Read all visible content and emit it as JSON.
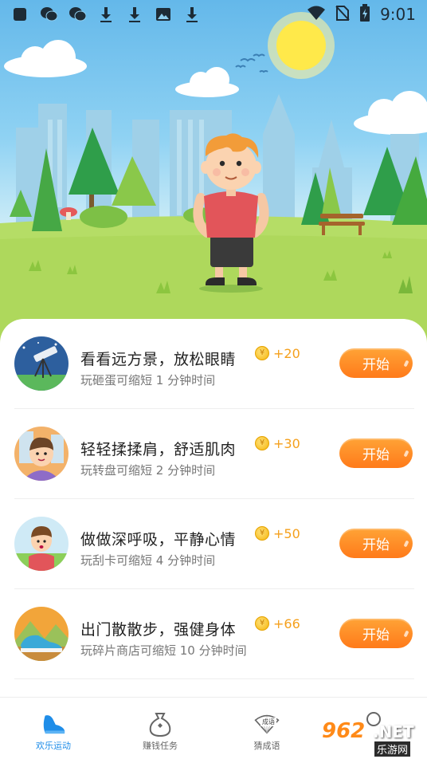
{
  "status_bar": {
    "time": "9:01",
    "left_icons": [
      "square-icon",
      "wechat-icon",
      "wechat-icon",
      "download-icon",
      "download-icon",
      "image-icon",
      "download-icon"
    ],
    "right_icons": [
      "wifi-icon",
      "no-sim-icon",
      "battery-charging-icon"
    ]
  },
  "tasks": [
    {
      "title": "看看远方景，放松眼睛",
      "reward": "+20",
      "subtitle": "玩砸蛋可缩短 1 分钟时间",
      "button": "开始",
      "avatar": "telescope"
    },
    {
      "title": "轻轻揉揉肩，舒适肌肉",
      "reward": "+30",
      "subtitle": "玩转盘可缩短 2 分钟时间",
      "button": "开始",
      "avatar": "shoulder-boy"
    },
    {
      "title": "做做深呼吸，平静心情",
      "reward": "+50",
      "subtitle": "玩刮卡可缩短 4 分钟时间",
      "button": "开始",
      "avatar": "breathing-boy"
    },
    {
      "title": "出门散散步，强健身体",
      "reward": "+66",
      "subtitle": "玩碎片商店可缩短 10 分钟时间",
      "button": "开始",
      "avatar": "walking-shoe"
    }
  ],
  "coin_symbol": "¥",
  "tabs": [
    {
      "label": "欢乐运动",
      "icon": "shoe-icon",
      "active": true
    },
    {
      "label": "赚钱任务",
      "icon": "money-bag-icon",
      "active": false
    },
    {
      "label": "猜成语",
      "icon": "fan-icon",
      "fan_text": "成语",
      "active": false
    },
    {
      "label": "",
      "icon": "profile-icon",
      "active": false
    }
  ],
  "watermark": {
    "number": "962",
    "domain": ".NET",
    "name": "乐游网"
  },
  "colors": {
    "accent": "#1f8de8",
    "button": "#ff8a26",
    "reward": "#f5a01c"
  }
}
